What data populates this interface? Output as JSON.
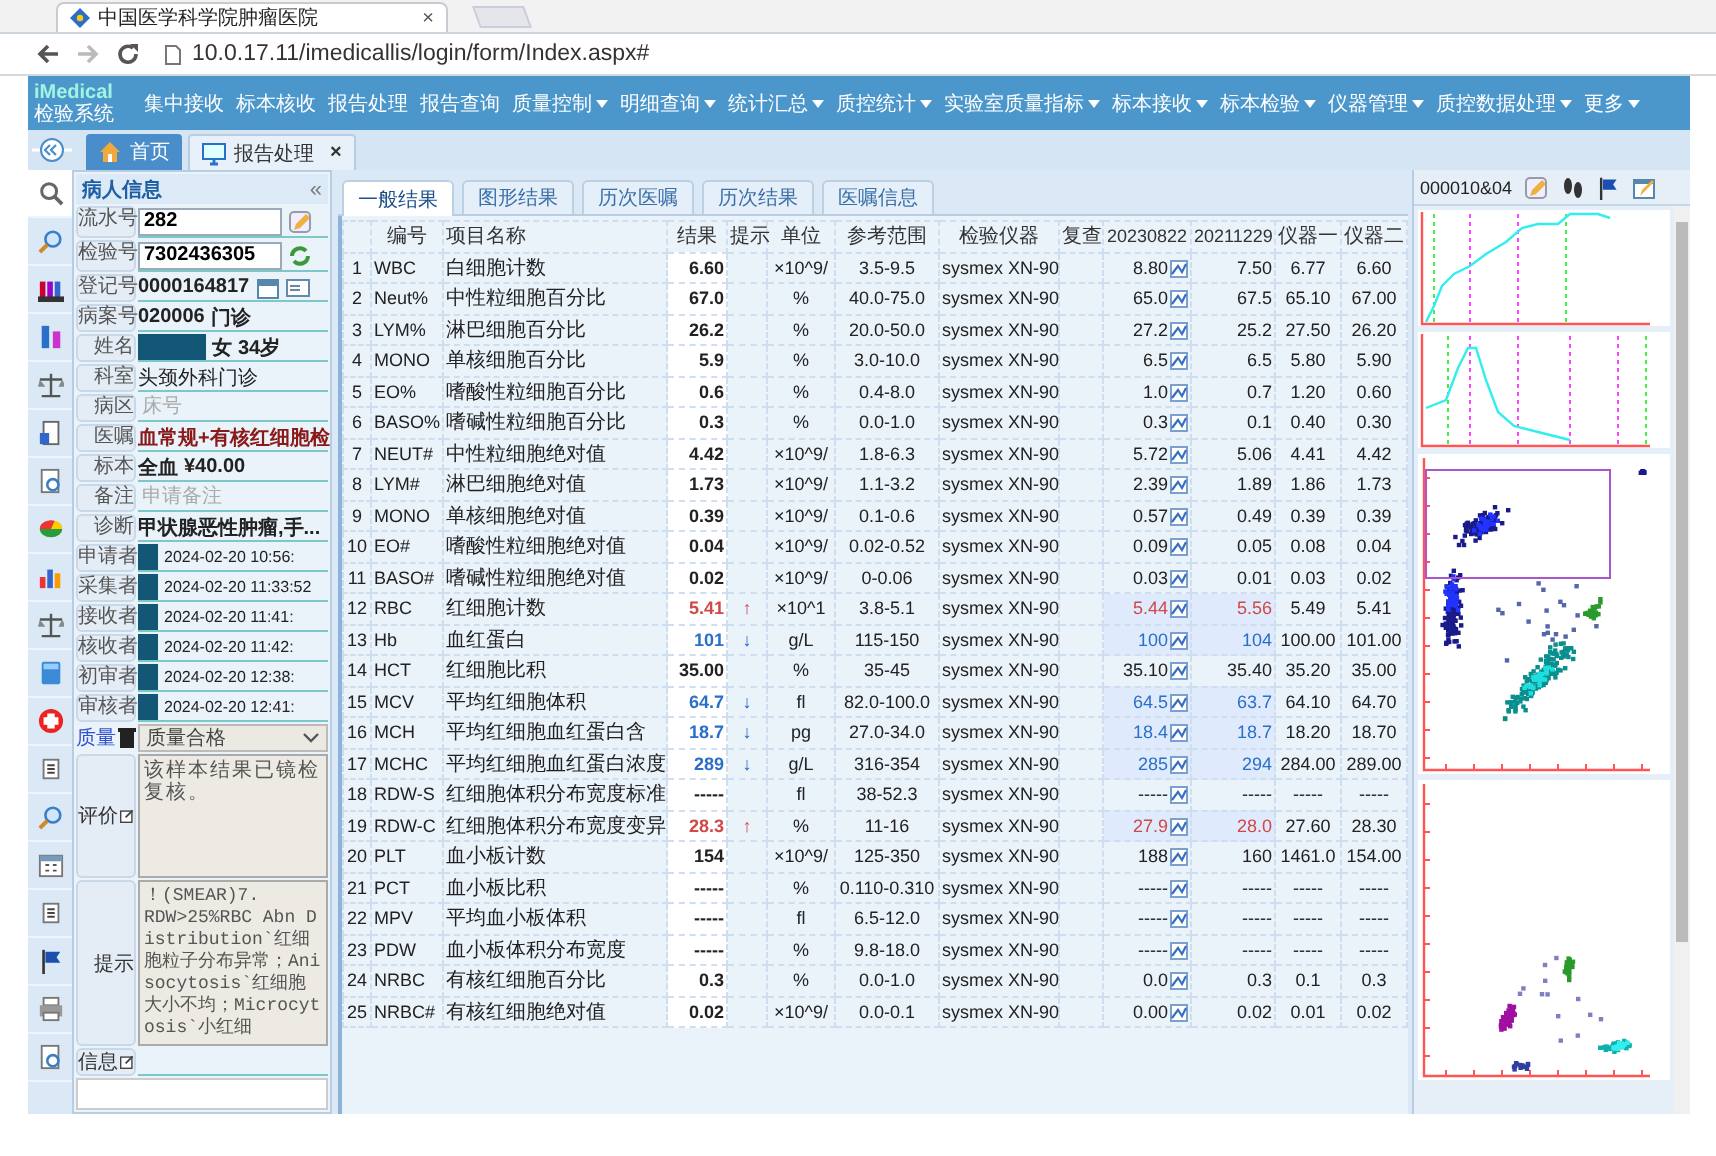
{
  "browser": {
    "tab_title": "中国医学科学院肿瘤医院",
    "tab_close": "×",
    "url": "10.0.17.11/imedicallis/login/form/Index.aspx#"
  },
  "app": {
    "logo": "iMedical",
    "subtitle": "检验系统",
    "menu": [
      {
        "label": "集中接收",
        "dropdown": false
      },
      {
        "label": "标本核收",
        "dropdown": false
      },
      {
        "label": "报告处理",
        "dropdown": false
      },
      {
        "label": "报告查询",
        "dropdown": false
      },
      {
        "label": "质量控制",
        "dropdown": true
      },
      {
        "label": "明细查询",
        "dropdown": true
      },
      {
        "label": "统计汇总",
        "dropdown": true
      },
      {
        "label": "质控统计",
        "dropdown": true
      },
      {
        "label": "实验室质量指标",
        "dropdown": true
      },
      {
        "label": "标本接收",
        "dropdown": true
      },
      {
        "label": "标本检验",
        "dropdown": true
      },
      {
        "label": "仪器管理",
        "dropdown": true
      },
      {
        "label": "质控数据处理",
        "dropdown": true
      },
      {
        "label": "更多",
        "dropdown": true
      }
    ]
  },
  "page_tabs": [
    {
      "label": "首页",
      "kind": "home",
      "selected": false
    },
    {
      "label": "报告处理",
      "kind": "monitor",
      "selected": true,
      "close": "×"
    }
  ],
  "patient": {
    "title": "病人信息",
    "collapse": "«",
    "fields": [
      {
        "label": "流水号",
        "parts": [
          {
            "kind": "input",
            "text": "282"
          }
        ]
      },
      {
        "label": "检验号",
        "parts": [
          {
            "kind": "input",
            "text": "7302436305"
          }
        ]
      },
      {
        "label": "登记号",
        "parts": [
          {
            "kind": "bold",
            "text": "0000164817"
          }
        ]
      },
      {
        "label": "病案号",
        "parts": [
          {
            "kind": "bold",
            "text": "020006"
          },
          {
            "kind": "bold",
            "text": "门诊"
          }
        ]
      },
      {
        "label": "姓名",
        "parts": [
          {
            "kind": "redacted"
          },
          {
            "kind": "bold",
            "text": "女"
          },
          {
            "kind": "bold",
            "text": "34岁"
          }
        ]
      },
      {
        "label": "科室",
        "parts": [
          {
            "kind": "text",
            "text": "头颈外科门诊"
          }
        ]
      },
      {
        "label": "病区",
        "parts": [
          {
            "kind": "placeholder",
            "placeholder": "床号"
          }
        ]
      },
      {
        "label": "医嘱",
        "parts": [
          {
            "kind": "order",
            "text": "血常规+有核红细胞检"
          }
        ]
      },
      {
        "label": "标本",
        "parts": [
          {
            "kind": "bold",
            "text": "全血"
          },
          {
            "kind": "bold",
            "text": "¥40.00"
          }
        ]
      },
      {
        "label": "备注",
        "parts": [
          {
            "kind": "placeholder",
            "placeholder": "申请备注"
          }
        ]
      },
      {
        "label": "诊断",
        "parts": [
          {
            "kind": "bold",
            "text": "甲状腺恶性肿瘤,手..."
          }
        ]
      },
      {
        "label": "申请者",
        "parts": [
          {
            "kind": "redacted"
          },
          {
            "kind": "time",
            "text": "2024-02-20 10:56:"
          }
        ]
      },
      {
        "label": "采集者",
        "parts": [
          {
            "kind": "redacted"
          },
          {
            "kind": "time",
            "text": "2024-02-20 11:33:52"
          }
        ]
      },
      {
        "label": "接收者",
        "parts": [
          {
            "kind": "redacted"
          },
          {
            "kind": "time",
            "text": "2024-02-20 11:41:"
          }
        ]
      },
      {
        "label": "核收者",
        "parts": [
          {
            "kind": "redacted"
          },
          {
            "kind": "time",
            "text": "2024-02-20 11:42:"
          }
        ]
      },
      {
        "label": "初审者",
        "parts": [
          {
            "kind": "redacted"
          },
          {
            "kind": "time",
            "text": "2024-02-20 12:38:"
          }
        ]
      },
      {
        "label": "审核者",
        "parts": [
          {
            "kind": "redacted"
          },
          {
            "kind": "time",
            "text": "2024-02-20 12:41:"
          }
        ]
      }
    ],
    "quality": {
      "label": "质量",
      "value": "质量合格"
    },
    "evaluation": {
      "label": "评价",
      "value": "该样本结果已镜检复核。"
    },
    "hint": {
      "label": "提示",
      "value": "！(SMEAR)7.\nRDW>25%RBC Abn Distribution`红细胞粒子分布异常；Anisocytosis`红细胞大小不均；Microcytosis`小红细"
    },
    "info": {
      "label": "信息"
    }
  },
  "results": {
    "tabs": [
      {
        "label": "一般结果",
        "selected": true
      },
      {
        "label": "图形结果",
        "selected": false
      },
      {
        "label": "历次医嘱",
        "selected": false
      },
      {
        "label": "历次结果",
        "selected": false
      },
      {
        "label": "医嘱信息",
        "selected": false
      }
    ],
    "columns": [
      "编号",
      "项目名称",
      "结果",
      "提示",
      "单位",
      "参考范围",
      "检验仪器",
      "复查",
      "20230822",
      "20211229",
      "仪器一",
      "仪器二"
    ],
    "rows": [
      {
        "no": "1",
        "code": "WBC",
        "name": "白细胞计数",
        "result": "6.60",
        "high": false,
        "low": false,
        "unit": "×10^9/",
        "range": "3.5-9.5",
        "instrument": "sysmex XN-90",
        "history": [
          {
            "value": "8.80",
            "high": false,
            "low": false
          },
          {
            "value": "7.50",
            "high": false,
            "low": false
          }
        ],
        "devices": [
          "6.77",
          "6.60"
        ]
      },
      {
        "no": "2",
        "code": "Neut%",
        "name": "中性粒细胞百分比",
        "result": "67.0",
        "high": false,
        "low": false,
        "unit": "%",
        "range": "40.0-75.0",
        "instrument": "sysmex XN-90",
        "history": [
          {
            "value": "65.0",
            "high": false,
            "low": false
          },
          {
            "value": "67.5",
            "high": false,
            "low": false
          }
        ],
        "devices": [
          "65.10",
          "67.00"
        ]
      },
      {
        "no": "3",
        "code": "LYM%",
        "name": "淋巴细胞百分比",
        "result": "26.2",
        "high": false,
        "low": false,
        "unit": "%",
        "range": "20.0-50.0",
        "instrument": "sysmex XN-90",
        "history": [
          {
            "value": "27.2",
            "high": false,
            "low": false
          },
          {
            "value": "25.2",
            "high": false,
            "low": false
          }
        ],
        "devices": [
          "27.50",
          "26.20"
        ]
      },
      {
        "no": "4",
        "code": "MONO",
        "name": "单核细胞百分比",
        "result": "5.9",
        "high": false,
        "low": false,
        "unit": "%",
        "range": "3.0-10.0",
        "instrument": "sysmex XN-90",
        "history": [
          {
            "value": "6.5",
            "high": false,
            "low": false
          },
          {
            "value": "6.5",
            "high": false,
            "low": false
          }
        ],
        "devices": [
          "5.80",
          "5.90"
        ]
      },
      {
        "no": "5",
        "code": "EO%",
        "name": "嗜酸性粒细胞百分比",
        "result": "0.6",
        "high": false,
        "low": false,
        "unit": "%",
        "range": "0.4-8.0",
        "instrument": "sysmex XN-90",
        "history": [
          {
            "value": "1.0",
            "high": false,
            "low": false
          },
          {
            "value": "0.7",
            "high": false,
            "low": false
          }
        ],
        "devices": [
          "1.20",
          "0.60"
        ]
      },
      {
        "no": "6",
        "code": "BASO%",
        "name": "嗜碱性粒细胞百分比",
        "result": "0.3",
        "high": false,
        "low": false,
        "unit": "%",
        "range": "0.0-1.0",
        "instrument": "sysmex XN-90",
        "history": [
          {
            "value": "0.3",
            "high": false,
            "low": false
          },
          {
            "value": "0.1",
            "high": false,
            "low": false
          }
        ],
        "devices": [
          "0.40",
          "0.30"
        ]
      },
      {
        "no": "7",
        "code": "NEUT#",
        "name": "中性粒细胞绝对值",
        "result": "4.42",
        "high": false,
        "low": false,
        "unit": "×10^9/",
        "range": "1.8-6.3",
        "instrument": "sysmex XN-90",
        "history": [
          {
            "value": "5.72",
            "high": false,
            "low": false
          },
          {
            "value": "5.06",
            "high": false,
            "low": false
          }
        ],
        "devices": [
          "4.41",
          "4.42"
        ]
      },
      {
        "no": "8",
        "code": "LYM#",
        "name": "淋巴细胞绝对值",
        "result": "1.73",
        "high": false,
        "low": false,
        "unit": "×10^9/",
        "range": "1.1-3.2",
        "instrument": "sysmex XN-90",
        "history": [
          {
            "value": "2.39",
            "high": false,
            "low": false
          },
          {
            "value": "1.89",
            "high": false,
            "low": false
          }
        ],
        "devices": [
          "1.86",
          "1.73"
        ]
      },
      {
        "no": "9",
        "code": "MONO",
        "name": "单核细胞绝对值",
        "result": "0.39",
        "high": false,
        "low": false,
        "unit": "×10^9/",
        "range": "0.1-0.6",
        "instrument": "sysmex XN-90",
        "history": [
          {
            "value": "0.57",
            "high": false,
            "low": false
          },
          {
            "value": "0.49",
            "high": false,
            "low": false
          }
        ],
        "devices": [
          "0.39",
          "0.39"
        ]
      },
      {
        "no": "10",
        "code": "EO#",
        "name": "嗜酸性粒细胞绝对值",
        "result": "0.04",
        "high": false,
        "low": false,
        "unit": "×10^9/",
        "range": "0.02-0.52",
        "instrument": "sysmex XN-90",
        "history": [
          {
            "value": "0.09",
            "high": false,
            "low": false
          },
          {
            "value": "0.05",
            "high": false,
            "low": false
          }
        ],
        "devices": [
          "0.08",
          "0.04"
        ]
      },
      {
        "no": "11",
        "code": "BASO#",
        "name": "嗜碱性粒细胞绝对值",
        "result": "0.02",
        "high": false,
        "low": false,
        "unit": "×10^9/",
        "range": "0-0.06",
        "instrument": "sysmex XN-90",
        "history": [
          {
            "value": "0.03",
            "high": false,
            "low": false
          },
          {
            "value": "0.01",
            "high": false,
            "low": false
          }
        ],
        "devices": [
          "0.03",
          "0.02"
        ]
      },
      {
        "no": "12",
        "code": "RBC",
        "name": "红细胞计数",
        "result": "5.41",
        "high": true,
        "low": false,
        "hint": "↑",
        "unit": "×10^1",
        "range": "3.8-5.1",
        "instrument": "sysmex XN-90",
        "history": [
          {
            "value": "5.44",
            "high": true,
            "low": false
          },
          {
            "value": "5.56",
            "high": true,
            "low": false
          }
        ],
        "devices": [
          "5.49",
          "5.41"
        ]
      },
      {
        "no": "13",
        "code": "Hb",
        "name": "血红蛋白",
        "result": "101",
        "high": false,
        "low": true,
        "hint": "↓",
        "unit": "g/L",
        "range": "115-150",
        "instrument": "sysmex XN-90",
        "history": [
          {
            "value": "100",
            "high": false,
            "low": true
          },
          {
            "value": "104",
            "high": false,
            "low": true
          }
        ],
        "devices": [
          "100.00",
          "101.00"
        ]
      },
      {
        "no": "14",
        "code": "HCT",
        "name": "红细胞比积",
        "result": "35.00",
        "high": false,
        "low": false,
        "unit": "%",
        "range": "35-45",
        "instrument": "sysmex XN-90",
        "history": [
          {
            "value": "35.10",
            "high": false,
            "low": false
          },
          {
            "value": "35.40",
            "high": false,
            "low": false
          }
        ],
        "devices": [
          "35.20",
          "35.00"
        ]
      },
      {
        "no": "15",
        "code": "MCV",
        "name": "平均红细胞体积",
        "result": "64.7",
        "high": false,
        "low": true,
        "hint": "↓",
        "unit": "fl",
        "range": "82.0-100.0",
        "instrument": "sysmex XN-90",
        "history": [
          {
            "value": "64.5",
            "high": false,
            "low": true
          },
          {
            "value": "63.7",
            "high": false,
            "low": true
          }
        ],
        "devices": [
          "64.10",
          "64.70"
        ]
      },
      {
        "no": "16",
        "code": "MCH",
        "name": "平均红细胞血红蛋白含",
        "result": "18.7",
        "high": false,
        "low": true,
        "hint": "↓",
        "unit": "pg",
        "range": "27.0-34.0",
        "instrument": "sysmex XN-90",
        "history": [
          {
            "value": "18.4",
            "high": false,
            "low": true
          },
          {
            "value": "18.7",
            "high": false,
            "low": true
          }
        ],
        "devices": [
          "18.20",
          "18.70"
        ]
      },
      {
        "no": "17",
        "code": "MCHC",
        "name": "平均红细胞血红蛋白浓度",
        "result": "289",
        "high": false,
        "low": true,
        "hint": "↓",
        "unit": "g/L",
        "range": "316-354",
        "instrument": "sysmex XN-90",
        "history": [
          {
            "value": "285",
            "high": false,
            "low": true
          },
          {
            "value": "294",
            "high": false,
            "low": true
          }
        ],
        "devices": [
          "284.00",
          "289.00"
        ]
      },
      {
        "no": "18",
        "code": "RDW-S",
        "name": "红细胞体积分布宽度标准",
        "result": "-----",
        "high": false,
        "low": false,
        "unit": "fl",
        "range": "38-52.3",
        "instrument": "sysmex XN-90",
        "history": [
          {
            "value": "-----",
            "high": false,
            "low": false
          },
          {
            "value": "-----",
            "high": false,
            "low": false
          }
        ],
        "devices": [
          "-----",
          "-----"
        ]
      },
      {
        "no": "19",
        "code": "RDW-C",
        "name": "红细胞体积分布宽度变异",
        "result": "28.3",
        "high": true,
        "low": false,
        "hint": "↑",
        "unit": "%",
        "range": "11-16",
        "instrument": "sysmex XN-90",
        "history": [
          {
            "value": "27.9",
            "high": true,
            "low": false
          },
          {
            "value": "28.0",
            "high": true,
            "low": false
          }
        ],
        "devices": [
          "27.60",
          "28.30"
        ]
      },
      {
        "no": "20",
        "code": "PLT",
        "name": "血小板计数",
        "result": "154",
        "high": false,
        "low": false,
        "unit": "×10^9/",
        "range": "125-350",
        "instrument": "sysmex XN-90",
        "history": [
          {
            "value": "188",
            "high": false,
            "low": false
          },
          {
            "value": "160",
            "high": false,
            "low": false
          }
        ],
        "devices": [
          "1461.0",
          "154.00"
        ]
      },
      {
        "no": "21",
        "code": "PCT",
        "name": "血小板比积",
        "result": "-----",
        "high": false,
        "low": false,
        "unit": "%",
        "range": "0.110-0.310",
        "instrument": "sysmex XN-90",
        "history": [
          {
            "value": "-----",
            "high": false,
            "low": false
          },
          {
            "value": "-----",
            "high": false,
            "low": false
          }
        ],
        "devices": [
          "-----",
          "-----"
        ]
      },
      {
        "no": "22",
        "code": "MPV",
        "name": "平均血小板体积",
        "result": "-----",
        "high": false,
        "low": false,
        "unit": "fl",
        "range": "6.5-12.0",
        "instrument": "sysmex XN-90",
        "history": [
          {
            "value": "-----",
            "high": false,
            "low": false
          },
          {
            "value": "-----",
            "high": false,
            "low": false
          }
        ],
        "devices": [
          "-----",
          "-----"
        ]
      },
      {
        "no": "23",
        "code": "PDW",
        "name": "血小板体积分布宽度",
        "result": "-----",
        "high": false,
        "low": false,
        "unit": "%",
        "range": "9.8-18.0",
        "instrument": "sysmex XN-90",
        "history": [
          {
            "value": "-----",
            "high": false,
            "low": false
          },
          {
            "value": "-----",
            "high": false,
            "low": false
          }
        ],
        "devices": [
          "-----",
          "-----"
        ]
      },
      {
        "no": "24",
        "code": "NRBC",
        "name": "有核红细胞百分比",
        "result": "0.3",
        "high": false,
        "low": false,
        "unit": "%",
        "range": "0.0-1.0",
        "instrument": "sysmex XN-90",
        "history": [
          {
            "value": "0.0",
            "high": false,
            "low": false
          },
          {
            "value": "0.3",
            "high": false,
            "low": false
          }
        ],
        "devices": [
          "0.1",
          "0.3"
        ]
      },
      {
        "no": "25",
        "code": "NRBC#",
        "name": "有核红细胞绝对值",
        "result": "0.02",
        "high": false,
        "low": false,
        "unit": "×10^9/",
        "range": "0.0-0.1",
        "instrument": "sysmex XN-90",
        "history": [
          {
            "value": "0.00",
            "high": false,
            "low": false
          },
          {
            "value": "0.02",
            "high": false,
            "low": false
          }
        ],
        "devices": [
          "0.01",
          "0.02"
        ]
      }
    ]
  },
  "graphs": {
    "sample_code": "000010&04"
  }
}
